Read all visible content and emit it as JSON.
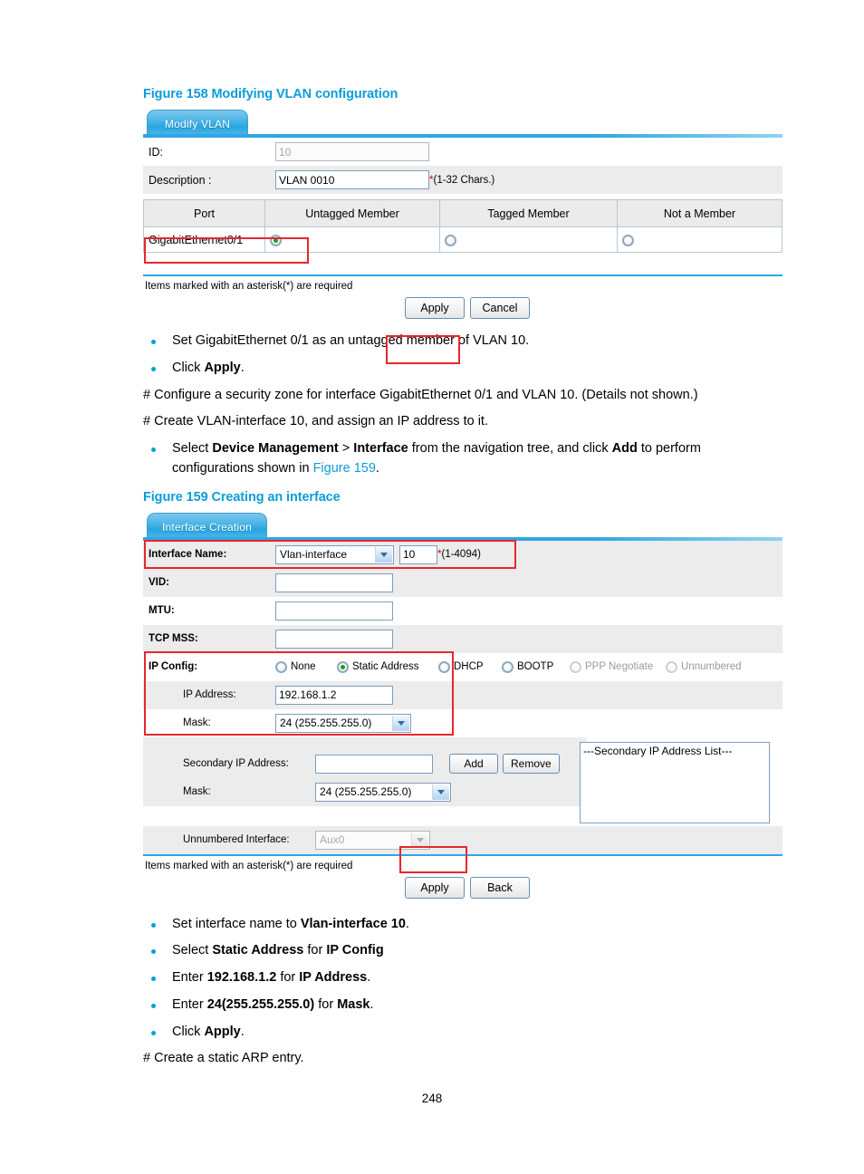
{
  "document": {
    "page_number": "248"
  },
  "figure158": {
    "caption": "Figure 158 Modifying VLAN configuration",
    "tab_label": "Modify VLAN",
    "fields": {
      "id_label": "ID:",
      "id_value": "10",
      "description_label": "Description :",
      "description_value": "VLAN 0010",
      "description_required_mark": "*",
      "description_hint": "(1-32 Chars.)"
    },
    "table": {
      "headers": [
        "Port",
        "Untagged Member",
        "Tagged Member",
        "Not a Member"
      ],
      "rows": [
        {
          "port": "GigabitEthernet0/1",
          "untagged": true,
          "tagged": false,
          "not_member": false
        }
      ]
    },
    "required_note": "Items marked with an asterisk(*) are required",
    "buttons": {
      "apply": "Apply",
      "cancel": "Cancel"
    }
  },
  "between_text": {
    "bullet1": "Set GigabitEthernet 0/1 as an untagged member of VLAN 10.",
    "bullet2_prefix": "Click ",
    "bullet2_bold": "Apply",
    "bullet2_suffix": ".",
    "para1": "# Configure a security zone for interface GigabitEthernet 0/1 and VLAN 10. (Details not shown.)",
    "para2": "# Create VLAN-interface 10, and assign an IP address to it.",
    "bullet3_a": "Select ",
    "bullet3_b": "Device Management",
    "bullet3_c": " > ",
    "bullet3_d": "Interface",
    "bullet3_e": " from the navigation tree, and click ",
    "bullet3_f": "Add",
    "bullet3_g": " to perform configurations shown in ",
    "bullet3_xref": "Figure 159",
    "bullet3_h": "."
  },
  "figure159": {
    "caption": "Figure 159 Creating an interface",
    "tab_label": "Interface Creation",
    "fields": {
      "interface_name_label": "Interface Name:",
      "interface_name_value": "Vlan-interface",
      "interface_number_value": "10",
      "interface_required_mark": "*",
      "interface_hint": "(1-4094)",
      "vid_label": "VID:",
      "vid_value": "",
      "mtu_label": "MTU:",
      "mtu_value": "",
      "tcp_mss_label": "TCP MSS:",
      "tcp_mss_value": "",
      "ip_config_label": "IP Config:",
      "ip_config_options": [
        {
          "label": "None",
          "selected": false,
          "disabled": false
        },
        {
          "label": "Static Address",
          "selected": true,
          "disabled": false
        },
        {
          "label": "DHCP",
          "selected": false,
          "disabled": false
        },
        {
          "label": "BOOTP",
          "selected": false,
          "disabled": false
        },
        {
          "label": "PPP Negotiate",
          "selected": false,
          "disabled": true
        },
        {
          "label": "Unnumbered",
          "selected": false,
          "disabled": true
        }
      ],
      "ip_address_label": "IP Address:",
      "ip_address_value": "192.168.1.2",
      "mask_label": "Mask:",
      "mask_value": "24 (255.255.255.0)",
      "secondary_ip_label": "Secondary IP Address:",
      "secondary_ip_value": "",
      "secondary_mask_label": "Mask:",
      "secondary_mask_value": "24 (255.255.255.0)",
      "add_button": "Add",
      "remove_button": "Remove",
      "secondary_list_header": "---Secondary IP Address List---",
      "unnumbered_label": "Unnumbered Interface:",
      "unnumbered_value": "Aux0"
    },
    "required_note": "Items marked with an asterisk(*) are required",
    "buttons": {
      "apply": "Apply",
      "back": "Back"
    }
  },
  "bottom_text": {
    "b1_a": "Set interface name to ",
    "b1_b": "Vlan-interface 10",
    "b1_c": ".",
    "b2_a": "Select ",
    "b2_b": "Static Address",
    "b2_c": " for ",
    "b2_d": "IP Config",
    "b3_a": "Enter ",
    "b3_b": "192.168.1.2",
    "b3_c": " for ",
    "b3_d": "IP Address",
    "b3_e": ".",
    "b4_a": "Enter ",
    "b4_b": "24(255.255.255.0)",
    "b4_c": " for ",
    "b4_d": "Mask",
    "b4_e": ".",
    "b5_a": "Click ",
    "b5_b": "Apply",
    "b5_c": ".",
    "para_final": "# Create a static ARP entry."
  }
}
